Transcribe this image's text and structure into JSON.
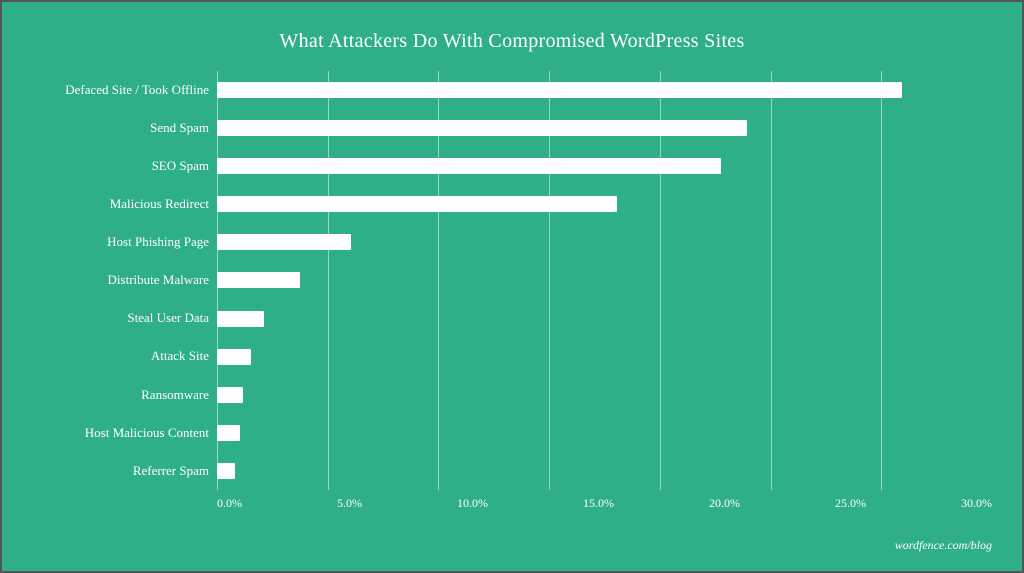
{
  "chart": {
    "title": "What Attackers Do With Compromised WordPress Sites",
    "watermark": "wordfence.com/blog",
    "maxValue": 30,
    "xLabels": [
      "0.0%",
      "5.0%",
      "10.0%",
      "15.0%",
      "20.0%",
      "25.0%",
      "30.0%"
    ],
    "bars": [
      {
        "label": "Defaced Site / Took Offline",
        "value": 26.5
      },
      {
        "label": "Send Spam",
        "value": 20.5
      },
      {
        "label": "SEO Spam",
        "value": 19.5
      },
      {
        "label": "Malicious Redirect",
        "value": 15.5
      },
      {
        "label": "Host Phishing Page",
        "value": 5.2
      },
      {
        "label": "Distribute Malware",
        "value": 3.2
      },
      {
        "label": "Steal User Data",
        "value": 1.8
      },
      {
        "label": "Attack Site",
        "value": 1.3
      },
      {
        "label": "Ransomware",
        "value": 1.0
      },
      {
        "label": "Host Malicious Content",
        "value": 0.9
      },
      {
        "label": "Referrer Spam",
        "value": 0.7
      }
    ]
  }
}
